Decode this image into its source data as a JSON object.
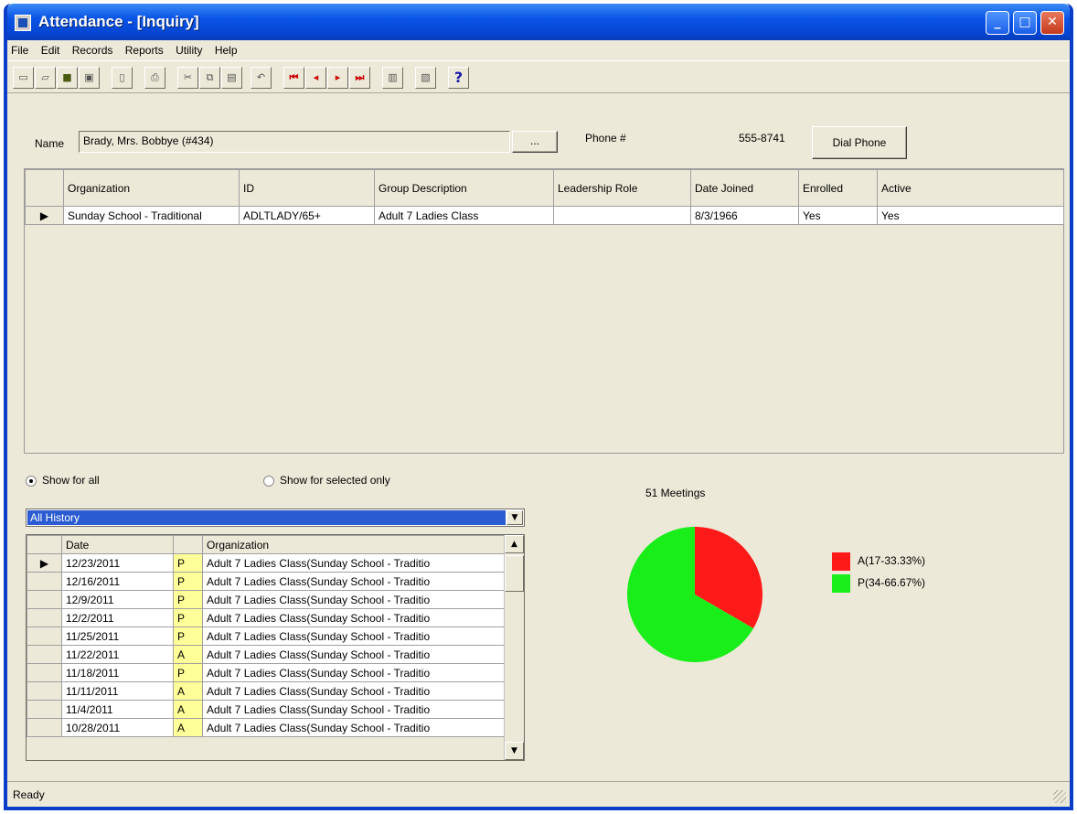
{
  "window": {
    "title": "Attendance - [Inquiry]"
  },
  "menu": [
    "File",
    "Edit",
    "Records",
    "Reports",
    "Utility",
    "Help"
  ],
  "toolbar": {
    "icons": [
      "new-icon",
      "open-icon",
      "open-folder-icon",
      "save-icon",
      "delete-icon",
      "print-icon",
      "cut-icon",
      "copy-icon",
      "paste-icon",
      "undo-icon",
      "first-record-icon",
      "previous-record-icon",
      "next-record-icon",
      "last-record-icon",
      "report-icon",
      "notes-icon",
      "help-icon"
    ]
  },
  "person": {
    "name_label": "Name",
    "name_value": "Brady, Mrs. Bobbye (#434)",
    "browse_label": "...",
    "phone_label": "Phone #",
    "phone_value": "555-8741",
    "dial_label": "Dial Phone"
  },
  "groups": {
    "columns": [
      "Organization",
      "ID",
      "Group Description",
      "Leadership Role",
      "Date Joined",
      "Enrolled",
      "Active"
    ],
    "rows": [
      [
        "Sunday School - Traditional",
        "ADLTLADY/65+",
        "Adult 7 Ladies Class",
        "",
        "8/3/1966",
        "Yes",
        "Yes"
      ]
    ]
  },
  "filter": {
    "show_all": "Show for all",
    "show_selected": "Show for selected only",
    "history_value": "All History"
  },
  "history": {
    "columns": [
      "Date",
      "",
      "Organization"
    ],
    "rows": [
      [
        "12/23/2011",
        "P",
        "Adult 7 Ladies Class(Sunday School - Traditio"
      ],
      [
        "12/16/2011",
        "P",
        "Adult 7 Ladies Class(Sunday School - Traditio"
      ],
      [
        "12/9/2011",
        "P",
        "Adult 7 Ladies Class(Sunday School - Traditio"
      ],
      [
        "12/2/2011",
        "P",
        "Adult 7 Ladies Class(Sunday School - Traditio"
      ],
      [
        "11/25/2011",
        "P",
        "Adult 7 Ladies Class(Sunday School - Traditio"
      ],
      [
        "11/22/2011",
        "A",
        "Adult 7 Ladies Class(Sunday School - Traditio"
      ],
      [
        "11/18/2011",
        "P",
        "Adult 7 Ladies Class(Sunday School - Traditio"
      ],
      [
        "11/11/2011",
        "A",
        "Adult 7 Ladies Class(Sunday School - Traditio"
      ],
      [
        "11/4/2011",
        "A",
        "Adult 7 Ladies Class(Sunday School - Traditio"
      ],
      [
        "10/28/2011",
        "A",
        "Adult 7 Ladies Class(Sunday School - Traditio"
      ]
    ]
  },
  "chart_data": {
    "type": "pie",
    "title": "51 Meetings",
    "categories": [
      "A(17-33.33%)",
      "P(34-66.67%)"
    ],
    "values": [
      17,
      34
    ],
    "colors": [
      "#ff1a1a",
      "#1aee1a"
    ],
    "legend_position": "right"
  },
  "status": {
    "text": "Ready"
  }
}
